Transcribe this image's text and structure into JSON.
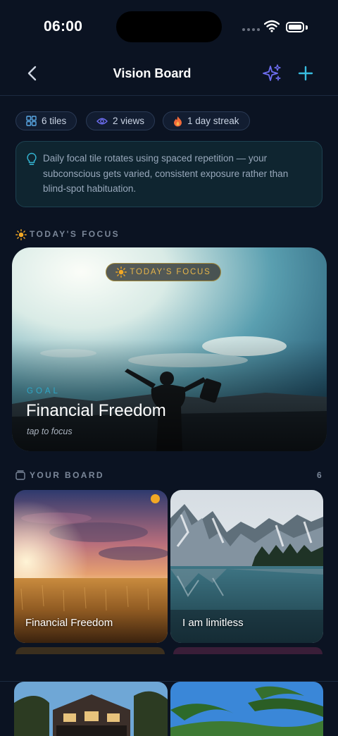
{
  "status_bar": {
    "time": "06:00"
  },
  "header": {
    "title": "Vision Board",
    "back_icon": "chevron-left-icon",
    "magic_icon": "sparkles-icon",
    "add_icon": "plus-icon"
  },
  "stats": [
    {
      "icon": "grid-icon",
      "label": "6 tiles"
    },
    {
      "icon": "eye-icon",
      "label": "2 views"
    },
    {
      "icon": "flame-icon",
      "label": "1 day streak"
    }
  ],
  "tip": {
    "icon": "lightbulb-icon",
    "text": "Daily focal tile rotates using spaced repetition — your subconscious gets varied, consistent exposure rather than blind-spot habituation."
  },
  "focus_section": {
    "icon": "sun-icon",
    "label": "TODAY'S FOCUS"
  },
  "hero": {
    "badge": "TODAY'S FOCUS",
    "kind": "GOAL",
    "title": "Financial Freedom",
    "hint": "tap to focus"
  },
  "board_section": {
    "icon": "board-icon",
    "label": "YOUR BOARD",
    "count": "6"
  },
  "tiles": [
    {
      "label": "Financial Freedom",
      "image": "wheat field at sunset",
      "focused": true
    },
    {
      "label": "I am limitless",
      "image": "mountain lake reflection"
    }
  ],
  "colors": {
    "background": "#0b1322",
    "accent": "#2fa7c7",
    "focus_gold": "#f2a825"
  }
}
